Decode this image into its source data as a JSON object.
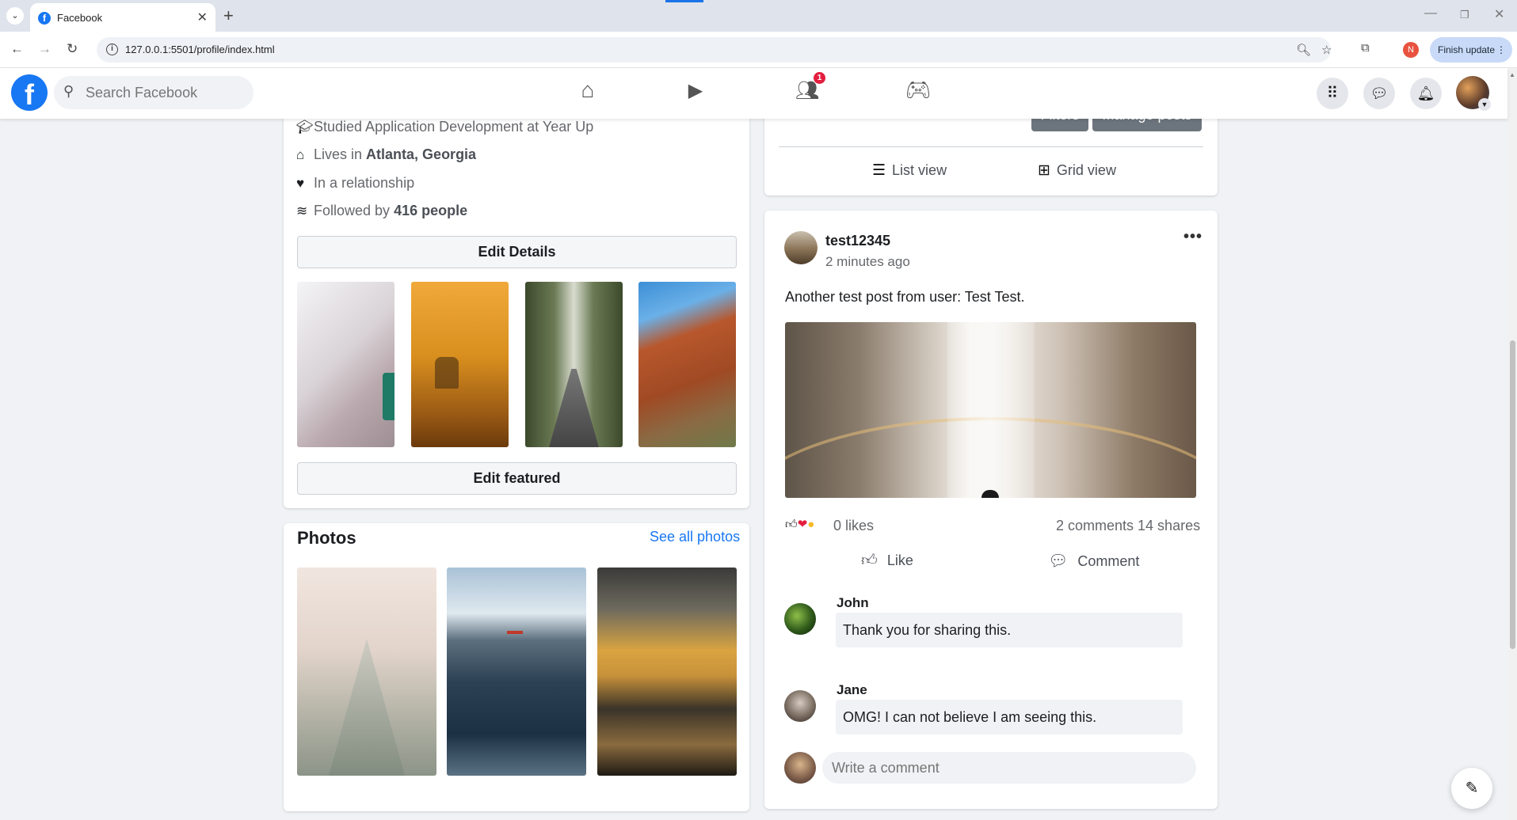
{
  "browser": {
    "tab_title": "Facebook",
    "url": "127.0.0.1:5501/profile/index.html",
    "profile_initial": "N",
    "finish_update_label": "Finish update"
  },
  "nav": {
    "search_placeholder": "Search Facebook",
    "groups_badge": "1"
  },
  "intro": {
    "details": [
      {
        "icon": "graduation-cap-icon",
        "prefix": "Studied Application Development at Year Up",
        "bold": ""
      },
      {
        "icon": "home-icon",
        "prefix": "Lives in ",
        "bold": "Atlanta, Georgia"
      },
      {
        "icon": "heart-icon",
        "prefix": "In a relationship",
        "bold": ""
      },
      {
        "icon": "rss-icon",
        "prefix": "Followed by ",
        "bold": "416 people"
      }
    ],
    "edit_details_label": "Edit Details",
    "edit_featured_label": "Edit featured"
  },
  "photos": {
    "title": "Photos",
    "see_all_label": "See all photos"
  },
  "filters": {
    "filters_label": "Filters",
    "manage_posts_label": "Manage posts",
    "list_view_label": "List view",
    "grid_view_label": "Grid view"
  },
  "post": {
    "author": "test12345",
    "time": "2 minutes ago",
    "text": "Another test post from user: Test Test.",
    "likes": "0 likes",
    "stats": "2 comments 14 shares",
    "like_label": "Like",
    "comment_label": "Comment",
    "comments": [
      {
        "name": "John",
        "text": "Thank you for sharing this."
      },
      {
        "name": "Jane",
        "text": "OMG! I can not believe I am seeing this."
      }
    ],
    "write_placeholder": "Write a comment"
  },
  "colors": {
    "brand": "#1877f2",
    "badge": "#e41e3f",
    "secondary_button": "#6c757d"
  }
}
